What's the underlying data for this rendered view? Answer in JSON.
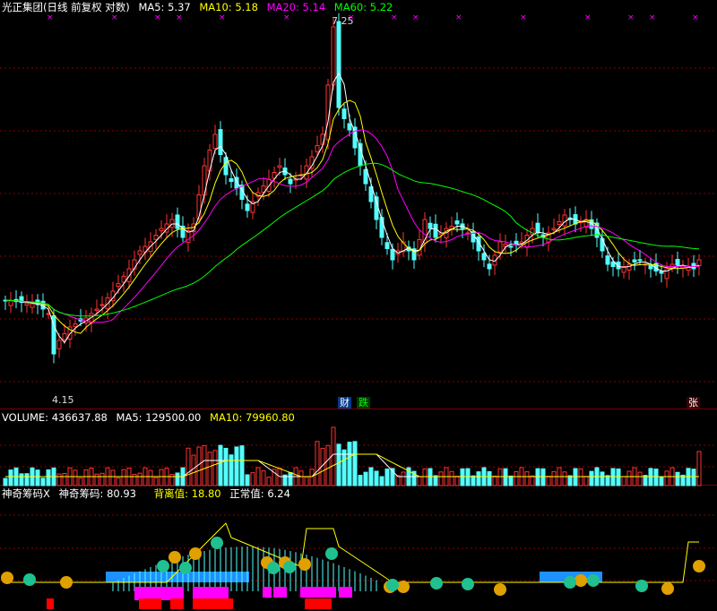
{
  "main": {
    "title": "光正集团(日线 前复权 对数)",
    "ma5": {
      "label": "MA5:",
      "value": "5.37",
      "color": "#ffffff"
    },
    "ma10": {
      "label": "MA10:",
      "value": "5.18",
      "color": "#ffff00"
    },
    "ma20": {
      "label": "MA20:",
      "value": "5.14",
      "color": "#ff00ff"
    },
    "ma60": {
      "label": "MA60:",
      "value": "5.22",
      "color": "#00ff00"
    },
    "high_label": "7.25",
    "low_label": "4.15",
    "tag_cai": "财",
    "tag_die": "跌",
    "tag_zhang": "张"
  },
  "volume": {
    "label": "VOLUME:",
    "value": "436637.88",
    "ma5_label": "MA5:",
    "ma5_value": "129500.00",
    "ma10_label": "MA10:",
    "ma10_value": "79960.80"
  },
  "indicator": {
    "name": "神奇筹码X",
    "line_label": "神奇筹码:",
    "line_value": "80.93",
    "dev_label": "背离值:",
    "dev_value": "18.80",
    "norm_label": "正常值:",
    "norm_value": "6.24"
  },
  "colors": {
    "up": "#ff3232",
    "down": "#54ffff",
    "grid": "#8b0000",
    "magenta": "#ff00ff",
    "blue": "#1e90ff"
  }
}
